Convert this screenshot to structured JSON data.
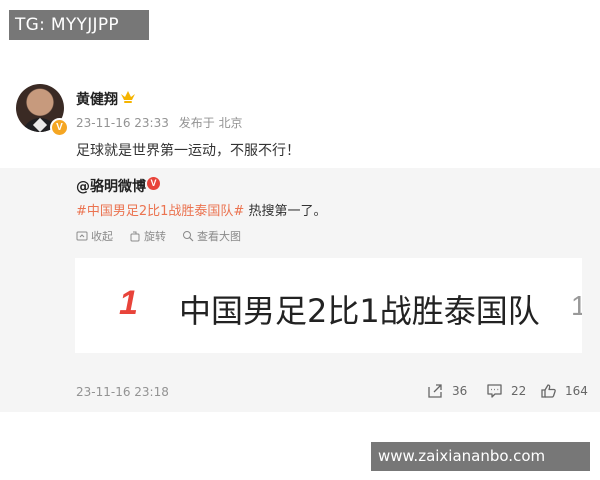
{
  "watermark_top": "TG: MYYJJPP",
  "watermark_bottom": "www.zaixiananbo.com",
  "post": {
    "author": "黄健翔",
    "verified_badge": "V",
    "crown_icon": "crown-icon",
    "time": "23-11-16 23:33",
    "source": "发布于 北京",
    "text": "足球就是世界第一运动，不服不行！"
  },
  "repost": {
    "author": "@骆明微博",
    "badge": "V",
    "hashtag": "#中国男足2比1战胜泰国队#",
    "text_rest": " 热搜第一了。",
    "actions": [
      "收起",
      "旋转",
      "查看大图"
    ],
    "card": {
      "rank": "1",
      "title": "中国男足2比1战胜泰国队",
      "next_rank": "1"
    },
    "time": "23-11-16 23:18",
    "stats": {
      "reposts": "36",
      "comments": "22",
      "likes": "164"
    }
  },
  "colors": {
    "hashtag": "#eb7350",
    "rank": "#e8433a",
    "verified_gold": "#f5a623",
    "verified_red": "#e8433a",
    "repost_bg": "#f5f5f5",
    "watermark_bg": "#777777"
  }
}
